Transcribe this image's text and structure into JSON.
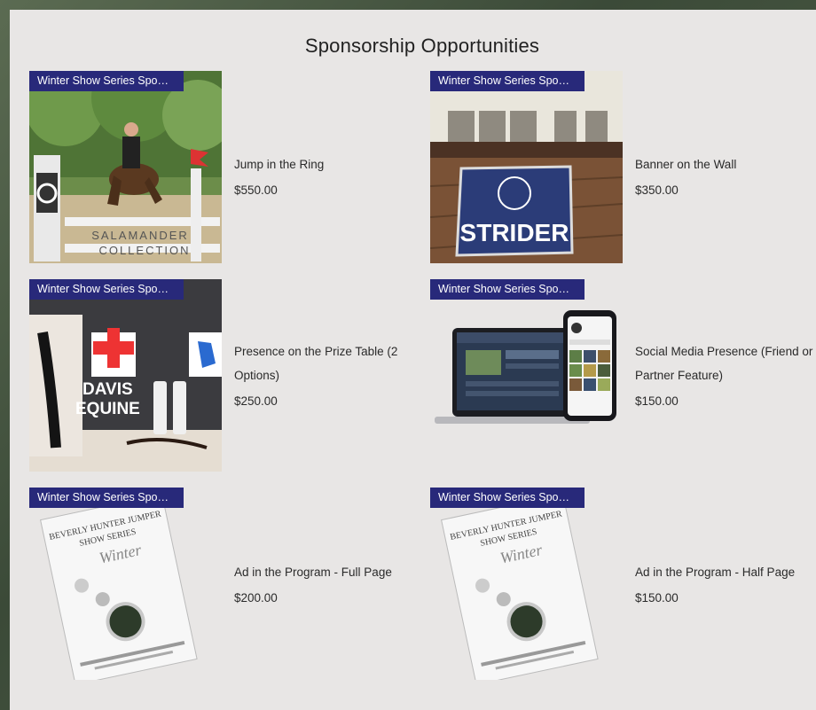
{
  "page": {
    "title": "Sponsorship Opportunities",
    "accent_color": "#28297a",
    "background_color": "#e8e6e5"
  },
  "products": [
    {
      "ribbon": "Winter Show Series Spo…",
      "name": "Jump in the Ring",
      "price": "$550.00",
      "image_text": [
        "SALAMANDER",
        "COLLECTION"
      ]
    },
    {
      "ribbon": "Winter Show Series Spo…",
      "name": "Banner on the Wall",
      "price": "$350.00",
      "image_text": [
        "STRIDER"
      ]
    },
    {
      "ribbon": "Winter Show Series Spo…",
      "name": "Presence on the Prize Table (2 Options)",
      "price": "$250.00",
      "image_text": [
        "DAVIS",
        "EQUINE"
      ]
    },
    {
      "ribbon": "Winter Show Series Spo…",
      "name": "Social Media Presence (Friend or Partner Feature)",
      "price": "$150.00",
      "image_text": []
    },
    {
      "ribbon": "Winter Show Series Spo…",
      "name": "Ad in the Program - Full Page",
      "price": "$200.00",
      "image_text": [
        "BEVERLY HUNTER JUMPER",
        "SHOW SERIES",
        "Winter"
      ]
    },
    {
      "ribbon": "Winter Show Series Spo…",
      "name": "Ad in the Program - Half Page",
      "price": "$150.00",
      "image_text": [
        "BEVERLY HUNTER JUMPER",
        "SHOW SERIES",
        "Winter"
      ]
    }
  ]
}
